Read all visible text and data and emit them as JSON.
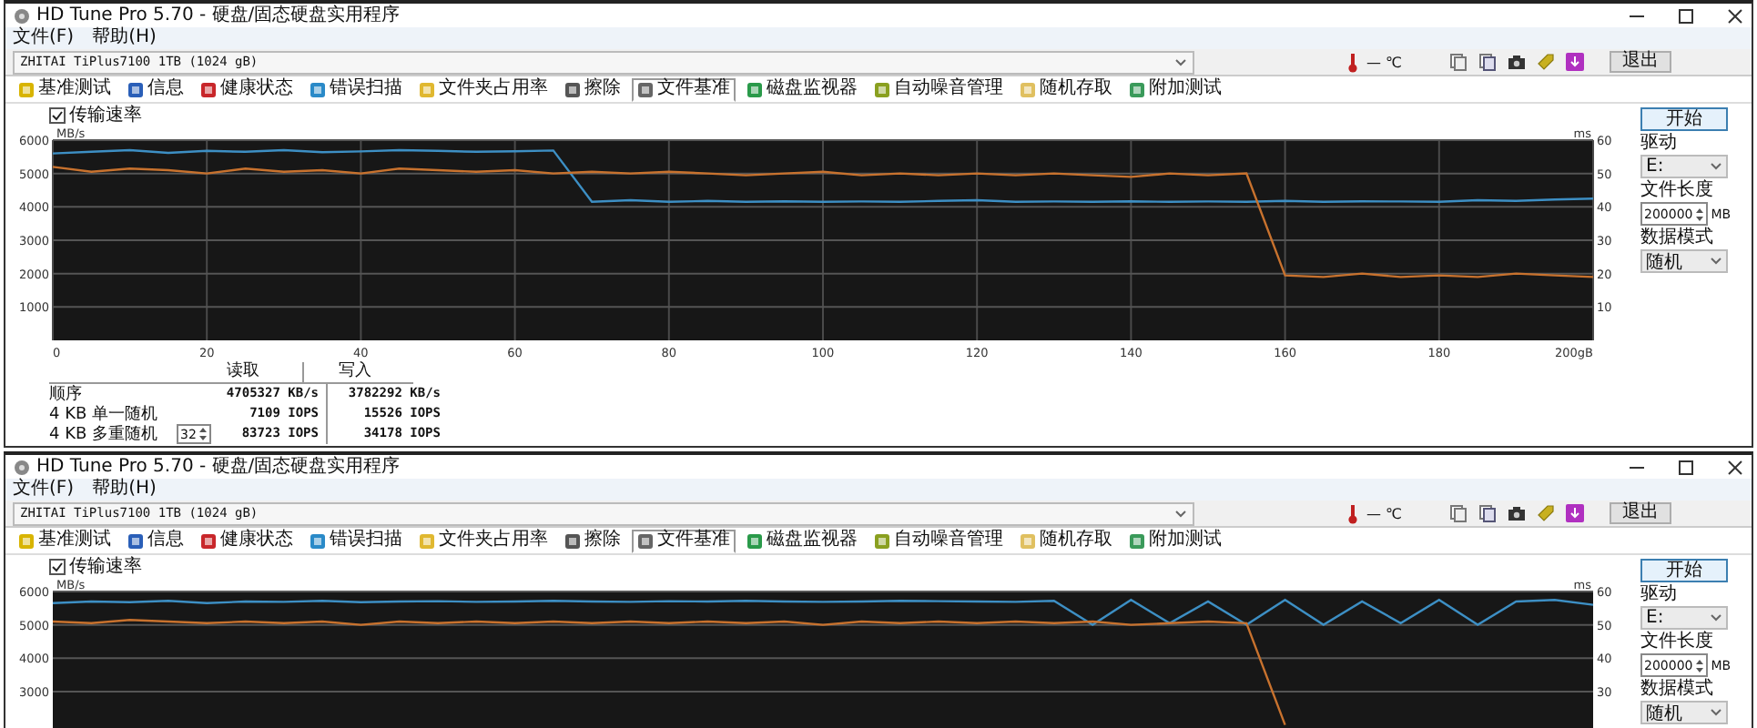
{
  "windows": [
    {
      "title": "HD Tune Pro 5.70 - 硬盘/固态硬盘实用程序",
      "menu": [
        "文件(F)",
        "帮助(H)"
      ],
      "drive": "ZHITAI TiPlus7100 1TB (1024 gB)",
      "temperature": "— ℃",
      "exit_button": "退出",
      "tabs": [
        {
          "label": "基准测试",
          "selected": false
        },
        {
          "label": "信息",
          "selected": false
        },
        {
          "label": "健康状态",
          "selected": false
        },
        {
          "label": "错误扫描",
          "selected": false
        },
        {
          "label": "文件夹占用率",
          "selected": false
        },
        {
          "label": "擦除",
          "selected": false
        },
        {
          "label": "文件基准",
          "selected": true
        },
        {
          "label": "磁盘监视器",
          "selected": false
        },
        {
          "label": "自动噪音管理",
          "selected": false
        },
        {
          "label": "随机存取",
          "selected": false
        },
        {
          "label": "附加测试",
          "selected": false
        }
      ],
      "checkbox": {
        "label": "传输速率",
        "checked": true
      },
      "chart_data": {
        "type": "line",
        "grid": true,
        "ylabel": "MB/s",
        "xlim": [
          0,
          200
        ],
        "ylim": [
          0,
          6000
        ],
        "yticks": [
          1000,
          2000,
          3000,
          4000,
          5000,
          6000
        ],
        "xticks": [
          0,
          20,
          40,
          60,
          80,
          100,
          120,
          140,
          160,
          180,
          {
            "value": 200,
            "label": "200gB"
          }
        ],
        "x": [
          0,
          5,
          10,
          15,
          20,
          25,
          30,
          35,
          40,
          45,
          50,
          55,
          60,
          65,
          70,
          75,
          80,
          85,
          90,
          95,
          100,
          105,
          110,
          115,
          120,
          125,
          130,
          135,
          140,
          145,
          150,
          155,
          160,
          165,
          170,
          175,
          180,
          185,
          190,
          195,
          200
        ],
        "series": [
          {
            "color": "#3d8fc4",
            "values": [
              5600,
              5650,
              5700,
              5620,
              5680,
              5650,
              5700,
              5640,
              5660,
              5700,
              5680,
              5650,
              5670,
              5690,
              4150,
              4200,
              4150,
              4180,
              4150,
              4170,
              4150,
              4160,
              4150,
              4180,
              4200,
              4150,
              4160,
              4150,
              4170,
              4150,
              4160,
              4150,
              4180,
              4150,
              4170,
              4160,
              4150,
              4200,
              4180,
              4220,
              4250
            ]
          },
          {
            "color": "#c8722e",
            "values": [
              5200,
              5050,
              5150,
              5100,
              5000,
              5150,
              5050,
              5100,
              5000,
              5150,
              5100,
              5050,
              5100,
              5000,
              5050,
              5000,
              5050,
              5000,
              4950,
              5000,
              5050,
              4950,
              5000,
              4950,
              5000,
              4950,
              5000,
              4950,
              4900,
              5000,
              4950,
              5000,
              1950,
              1900,
              2000,
              1900,
              1950,
              1900,
              2000,
              1950,
              1900
            ]
          }
        ]
      },
      "right_axis": {
        "label": "ms",
        "ticks": [
          "60",
          "50",
          "40",
          "30",
          "20",
          "10"
        ]
      },
      "side": {
        "start_button": "开始",
        "drive_label": "驱动",
        "drive_value": "E:",
        "length_label": "文件长度",
        "length_value": "200000",
        "length_unit": "MB",
        "mode_label": "数据模式",
        "mode_value": "随机"
      },
      "results": {
        "columns": [
          "读取",
          "写入"
        ],
        "rows": [
          {
            "label": "顺序",
            "read": "4705327 KB/s",
            "write": "3782292 KB/s"
          },
          {
            "label": "4 KB 单一随机",
            "read": "7109 IOPS",
            "write": "15526 IOPS"
          },
          {
            "label": "4 KB 多重随机",
            "queue": "32",
            "read": "83723 IOPS",
            "write": "34178 IOPS"
          }
        ]
      }
    },
    {
      "title": "HD Tune Pro 5.70 - 硬盘/固态硬盘实用程序",
      "menu": [
        "文件(F)",
        "帮助(H)"
      ],
      "drive": "ZHITAI TiPlus7100 1TB (1024 gB)",
      "temperature": "— ℃",
      "exit_button": "退出",
      "tabs": [
        {
          "label": "基准测试",
          "selected": false
        },
        {
          "label": "信息",
          "selected": false
        },
        {
          "label": "健康状态",
          "selected": false
        },
        {
          "label": "错误扫描",
          "selected": false
        },
        {
          "label": "文件夹占用率",
          "selected": false
        },
        {
          "label": "擦除",
          "selected": false
        },
        {
          "label": "文件基准",
          "selected": true
        },
        {
          "label": "磁盘监视器",
          "selected": false
        },
        {
          "label": "自动噪音管理",
          "selected": false
        },
        {
          "label": "随机存取",
          "selected": false
        },
        {
          "label": "附加测试",
          "selected": false
        }
      ],
      "checkbox": {
        "label": "传输速率",
        "checked": true
      },
      "chart_data": {
        "type": "line",
        "grid": true,
        "ylabel": "MB/s",
        "xlim": [
          0,
          200
        ],
        "ylim": [
          0,
          6000
        ],
        "yticks": [
          3000,
          4000,
          5000,
          6000
        ],
        "x": [
          0,
          5,
          10,
          15,
          20,
          25,
          30,
          35,
          40,
          45,
          50,
          55,
          60,
          65,
          70,
          75,
          80,
          85,
          90,
          95,
          100,
          105,
          110,
          115,
          120,
          125,
          130,
          135,
          140,
          145,
          150,
          155,
          160,
          165,
          170,
          175,
          180,
          185,
          190,
          195,
          200
        ],
        "series": [
          {
            "color": "#3d8fc4",
            "values": [
              5650,
              5700,
              5680,
              5720,
              5650,
              5700,
              5690,
              5720,
              5680,
              5700,
              5710,
              5690,
              5700,
              5720,
              5700,
              5690,
              5710,
              5700,
              5720,
              5700,
              5690,
              5700,
              5720,
              5710,
              5700,
              5690,
              5720,
              5000,
              5750,
              5050,
              5700,
              5000,
              5750,
              5000,
              5700,
              5050,
              5750,
              5000,
              5700,
              5750,
              5600
            ]
          },
          {
            "color": "#c8722e",
            "values": [
              5100,
              5050,
              5150,
              5100,
              5050,
              5100,
              5050,
              5100,
              5000,
              5100,
              5050,
              5100,
              5050,
              5100,
              5050,
              5100,
              5050,
              5100,
              5050,
              5100,
              5000,
              5100,
              5050,
              5100,
              5050,
              5100,
              5050,
              5100,
              5000,
              5050,
              5100,
              5050,
              2000,
              null,
              null,
              null,
              null,
              null,
              null,
              null,
              null
            ]
          }
        ]
      },
      "right_axis": {
        "label": "ms",
        "ticks": [
          "60",
          "50",
          "40",
          "30"
        ]
      },
      "side": {
        "start_button": "开始",
        "drive_label": "驱动",
        "drive_value": "E:",
        "length_label": "文件长度",
        "length_value": "200000",
        "length_unit": "MB",
        "mode_label": "数据模式",
        "mode_value": "随机"
      }
    }
  ]
}
